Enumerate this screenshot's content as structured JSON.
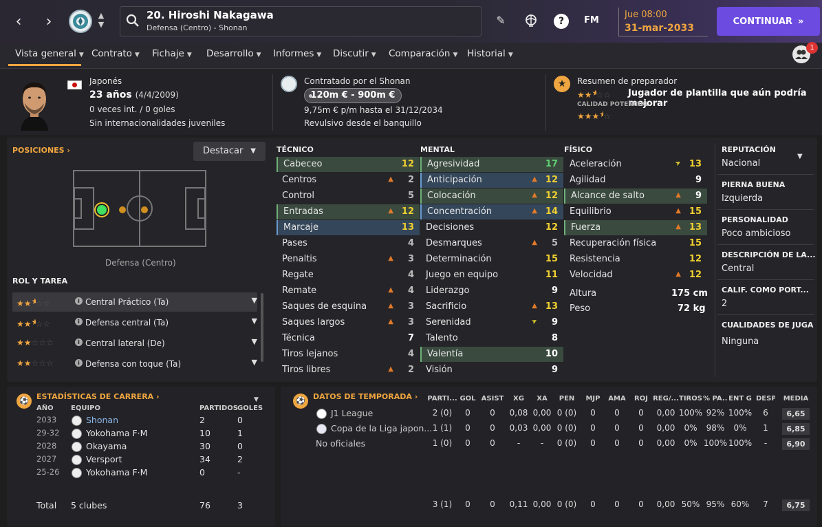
{
  "topbar": {
    "player_name": "20. Hiroshi Nakagawa",
    "player_sub": "Defensa (Centro) - Shonan",
    "fm_label": "FM",
    "help_label": "?",
    "time": "Jue 08:00",
    "date": "31-mar-2033",
    "continue_label": "CONTINUAR",
    "accent": "#6b4be0"
  },
  "tabs": [
    {
      "label": "Vista general"
    },
    {
      "label": "Contrato"
    },
    {
      "label": "Fichaje"
    },
    {
      "label": "Desarrollo"
    },
    {
      "label": "Informes"
    },
    {
      "label": "Discutir"
    },
    {
      "label": "Comparación"
    },
    {
      "label": "Historial"
    }
  ],
  "notifications": {
    "count": "1"
  },
  "header": {
    "nationality": "Japonés",
    "age": "23 años",
    "dob": "(4/4/2009)",
    "caps": "0 veces int. / 0 goles",
    "youth": "Sin internacionalidades juveniles",
    "contract_by": "Contratado por el Shonan",
    "value": "120m € - 900m €",
    "wage": "9,75m € p/m hasta el 31/12/2034",
    "squad_status": "Revulsivo desde el banquillo",
    "coach_title": "Resumen de preparador",
    "coach_summary": "Jugador de plantilla que aún podría mejorar",
    "potential_label": "CALIDAD POTENCIAL",
    "current_stars": 2.5,
    "potential_stars": 3.5
  },
  "positions": {
    "title": "POSICIONES",
    "filter": "Destacar",
    "position_label": "Defensa (Centro)",
    "roles_title": "ROL Y TAREA",
    "roles": [
      {
        "name": "Central Práctico (Ta)",
        "stars": 2.5
      },
      {
        "name": "Defensa central (Ta)",
        "stars": 2.5
      },
      {
        "name": "Central lateral (De)",
        "stars": 2
      },
      {
        "name": "Defensa con toque (Ta)",
        "stars": 2
      }
    ]
  },
  "attributes": {
    "technical_title": "TÉCNICO",
    "mental_title": "MENTAL",
    "physical_title": "FÍSICO",
    "technical": [
      {
        "name": "Cabeceo",
        "value": "12",
        "hl": "g",
        "trend": ""
      },
      {
        "name": "Centros",
        "value": "2",
        "hl": "",
        "trend": "up"
      },
      {
        "name": "Control",
        "value": "5",
        "hl": "",
        "trend": ""
      },
      {
        "name": "Entradas",
        "value": "12",
        "hl": "g",
        "trend": "up"
      },
      {
        "name": "Marcaje",
        "value": "13",
        "hl": "b",
        "trend": ""
      },
      {
        "name": "Pases",
        "value": "4",
        "hl": "",
        "trend": ""
      },
      {
        "name": "Penaltis",
        "value": "3",
        "hl": "",
        "trend": "up"
      },
      {
        "name": "Regate",
        "value": "4",
        "hl": "",
        "trend": ""
      },
      {
        "name": "Remate",
        "value": "4",
        "hl": "",
        "trend": "up"
      },
      {
        "name": "Saques de esquina",
        "value": "3",
        "hl": "",
        "trend": "up"
      },
      {
        "name": "Saques largos",
        "value": "3",
        "hl": "",
        "trend": "up"
      },
      {
        "name": "Técnica",
        "value": "7",
        "hl": "",
        "trend": ""
      },
      {
        "name": "Tiros lejanos",
        "value": "4",
        "hl": "",
        "trend": ""
      },
      {
        "name": "Tiros libres",
        "value": "2",
        "hl": "",
        "trend": "up"
      }
    ],
    "mental": [
      {
        "name": "Agresividad",
        "value": "17",
        "hl": "g",
        "trend": ""
      },
      {
        "name": "Anticipación",
        "value": "12",
        "hl": "b",
        "trend": "up"
      },
      {
        "name": "Colocación",
        "value": "12",
        "hl": "g",
        "trend": "up"
      },
      {
        "name": "Concentración",
        "value": "14",
        "hl": "b",
        "trend": "up"
      },
      {
        "name": "Decisiones",
        "value": "12",
        "hl": "",
        "trend": ""
      },
      {
        "name": "Desmarques",
        "value": "5",
        "hl": "",
        "trend": "up"
      },
      {
        "name": "Determinación",
        "value": "15",
        "hl": "",
        "trend": ""
      },
      {
        "name": "Juego en equipo",
        "value": "11",
        "hl": "",
        "trend": ""
      },
      {
        "name": "Liderazgo",
        "value": "9",
        "hl": "",
        "trend": ""
      },
      {
        "name": "Sacrificio",
        "value": "13",
        "hl": "",
        "trend": "up"
      },
      {
        "name": "Serenidad",
        "value": "9",
        "hl": "",
        "trend": "up2"
      },
      {
        "name": "Talento",
        "value": "8",
        "hl": "",
        "trend": ""
      },
      {
        "name": "Valentía",
        "value": "10",
        "hl": "g",
        "trend": ""
      },
      {
        "name": "Visión",
        "value": "9",
        "hl": "",
        "trend": ""
      }
    ],
    "physical": [
      {
        "name": "Aceleración",
        "value": "13",
        "hl": "",
        "trend": "up2"
      },
      {
        "name": "Agilidad",
        "value": "9",
        "hl": "",
        "trend": ""
      },
      {
        "name": "Alcance de salto",
        "value": "9",
        "hl": "g",
        "trend": "up"
      },
      {
        "name": "Equilibrio",
        "value": "15",
        "hl": "",
        "trend": "up"
      },
      {
        "name": "Fuerza",
        "value": "13",
        "hl": "g",
        "trend": "up"
      },
      {
        "name": "Recuperación física",
        "value": "15",
        "hl": "",
        "trend": ""
      },
      {
        "name": "Resistencia",
        "value": "12",
        "hl": "",
        "trend": ""
      },
      {
        "name": "Velocidad",
        "value": "12",
        "hl": "",
        "trend": "up"
      }
    ],
    "height_label": "Altura",
    "height": "175 cm",
    "weight_label": "Peso",
    "weight": "72 kg"
  },
  "profile": {
    "reputation_title": "REPUTACIÓN",
    "reputation": "Nacional",
    "foot_title": "PIERNA BUENA",
    "foot": "Izquierda",
    "personality_title": "PERSONALIDAD",
    "personality": "Poco ambicioso",
    "media_title": "DESCRIPCIÓN DE LA...",
    "media": "Central",
    "gk_title": "CALIF. COMO PORT...",
    "gk": "2",
    "qualities_title": "CUALIDADES DE JUGA",
    "qualities": "Ninguna"
  },
  "career": {
    "title": "ESTADÍSTICAS DE CARRERA",
    "h_year": "AÑO",
    "h_team": "EQUIPO",
    "h_apps": "PARTIDOS",
    "h_goals": "GOLES",
    "rows": [
      {
        "year": "2033",
        "team": "Shonan",
        "apps": "2",
        "goals": "0"
      },
      {
        "year": "29-32",
        "team": "Yokohama F·M",
        "apps": "10",
        "goals": "1"
      },
      {
        "year": "2028",
        "team": "Okayama",
        "apps": "30",
        "goals": "0"
      },
      {
        "year": "2027",
        "team": "Versport",
        "apps": "34",
        "goals": "2"
      },
      {
        "year": "25-26",
        "team": "Yokohama F·M",
        "apps": "0",
        "goals": "-"
      }
    ],
    "total_label": "Total",
    "total_clubs": "5 clubes",
    "total_apps": "76",
    "total_goals": "3"
  },
  "season": {
    "title": "DATOS DE TEMPORADA",
    "headers": [
      "PARTI...",
      "GOL",
      "ASIST",
      "XG",
      "XA",
      "PEN",
      "MJP",
      "AMA",
      "ROJ",
      "REG/...",
      "TIROS",
      "% PA...",
      "ENT G",
      "DESP",
      "MEDIA"
    ],
    "rows": [
      {
        "comp": "J1 League",
        "vals": [
          "2 (0)",
          "0",
          "0",
          "0,08",
          "0,00",
          "0 (0)",
          "0",
          "0",
          "0",
          "0,00",
          "100%",
          "92%",
          "100%",
          "6",
          "6,65"
        ]
      },
      {
        "comp": "Copa de la Liga japon...",
        "vals": [
          "1 (1)",
          "0",
          "0",
          "0,03",
          "0,00",
          "0 (0)",
          "0",
          "0",
          "0",
          "0,00",
          "0%",
          "98%",
          "0%",
          "1",
          "6,85"
        ]
      },
      {
        "comp": "No oficiales",
        "vals": [
          "1 (0)",
          "0",
          "0",
          "-",
          "-",
          "0 (0)",
          "0",
          "0",
          "0",
          "0,00",
          "0%",
          "100%",
          "100%",
          "-",
          "6,90"
        ]
      }
    ],
    "total": [
      "3 (1)",
      "0",
      "0",
      "0,11",
      "0,00",
      "0 (0)",
      "0",
      "0",
      "0",
      "0,00",
      "50%",
      "95%",
      "60%",
      "7",
      "6,75"
    ]
  }
}
